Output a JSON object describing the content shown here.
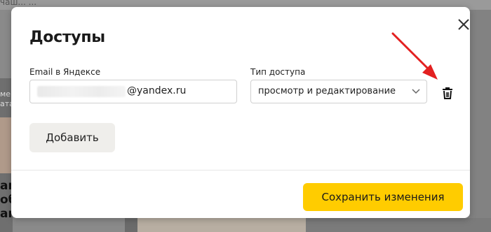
{
  "background": {
    "top_text": "чаш... ...",
    "left_texts": [
      "мен",
      "ата"
    ],
    "big_texts": [
      "ам",
      "об",
      "ам"
    ]
  },
  "dialog": {
    "title": "Доступы",
    "close_icon": "close-icon",
    "email_label": "Email в Яндексе",
    "email_domain": "@yandex.ru",
    "access_label": "Тип доступа",
    "access_value": "просмотр и редактирование",
    "delete_icon": "trash-icon",
    "add_button": "Добавить",
    "save_button": "Сохранить изменения"
  },
  "colors": {
    "accent": "#ffcc00",
    "annotation_arrow": "#e32020"
  }
}
